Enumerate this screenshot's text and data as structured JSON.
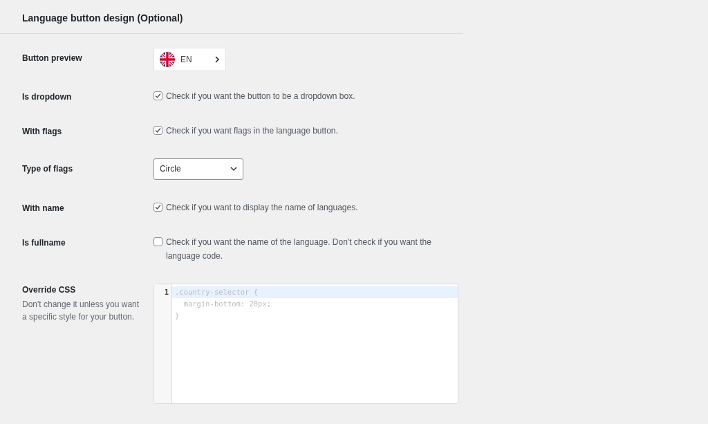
{
  "section": {
    "title": "Language button design (Optional)"
  },
  "rows": [
    {
      "kind": "preview",
      "label": "Button preview",
      "language_code": "EN"
    },
    {
      "kind": "checkbox",
      "label": "Is dropdown",
      "checked": true,
      "description": "Check if you want the button to be a dropdown box."
    },
    {
      "kind": "checkbox",
      "label": "With flags",
      "checked": true,
      "description": "Check if you want flags in the language button."
    },
    {
      "kind": "select",
      "label": "Type of flags",
      "value": "Circle"
    },
    {
      "kind": "checkbox",
      "label": "With name",
      "checked": true,
      "description": "Check if you want to display the name of languages."
    },
    {
      "kind": "checkbox",
      "label": "Is fullname",
      "checked": false,
      "description": "Check if you want the name of the language. Don't check if you want the language code."
    },
    {
      "kind": "code",
      "label": "Override CSS",
      "hint": "Don't change it unless you want a specific style for your button.",
      "line_numbers": [
        "1"
      ],
      "lines": [
        ".country-selector {",
        "  margin-bottom: 20px;",
        "}"
      ]
    }
  ]
}
